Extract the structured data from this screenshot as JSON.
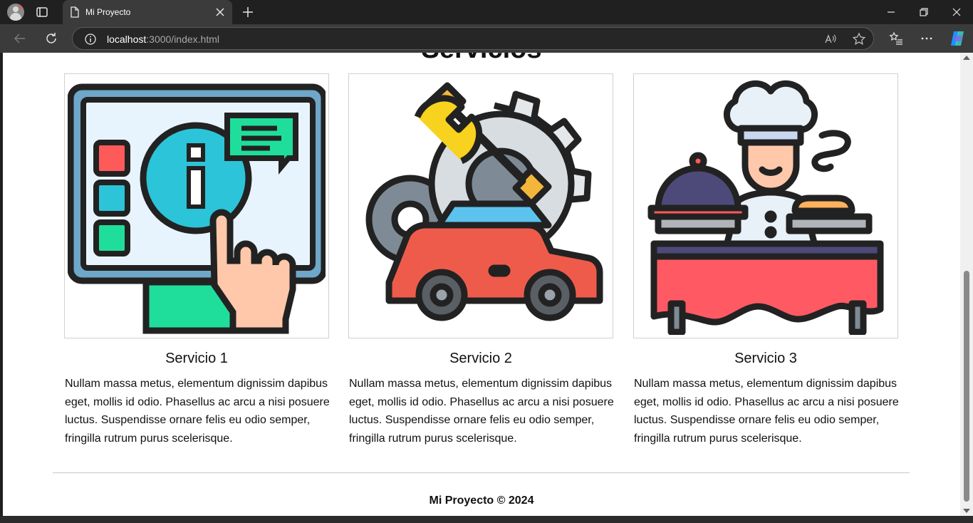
{
  "browser": {
    "tab_title": "Mi Proyecto",
    "url_host": "localhost",
    "url_rest": ":3000/index.html"
  },
  "page": {
    "section_title": "Servicios",
    "services": [
      {
        "title": "Servicio 1",
        "text": "Nullam massa metus, elementum dignissim dapibus eget, mollis id odio. Phasellus ac arcu a nisi posuere luctus. Suspendisse ornare felis eu odio semper, fringilla rutrum purus scelerisque.",
        "image_icon": "touchscreen-info-icon"
      },
      {
        "title": "Servicio 2",
        "text": "Nullam massa metus, elementum dignissim dapibus eget, mollis id odio. Phasellus ac arcu a nisi posuere luctus. Suspendisse ornare felis eu odio semper, fringilla rutrum purus scelerisque.",
        "image_icon": "car-repair-icon"
      },
      {
        "title": "Servicio 3",
        "text": "Nullam massa metus, elementum dignissim dapibus eget, mollis id odio. Phasellus ac arcu a nisi posuere luctus. Suspendisse ornare felis eu odio semper, fringilla rutrum purus scelerisque.",
        "image_icon": "chef-catering-icon"
      }
    ],
    "footer": "Mi Proyecto © 2024"
  }
}
